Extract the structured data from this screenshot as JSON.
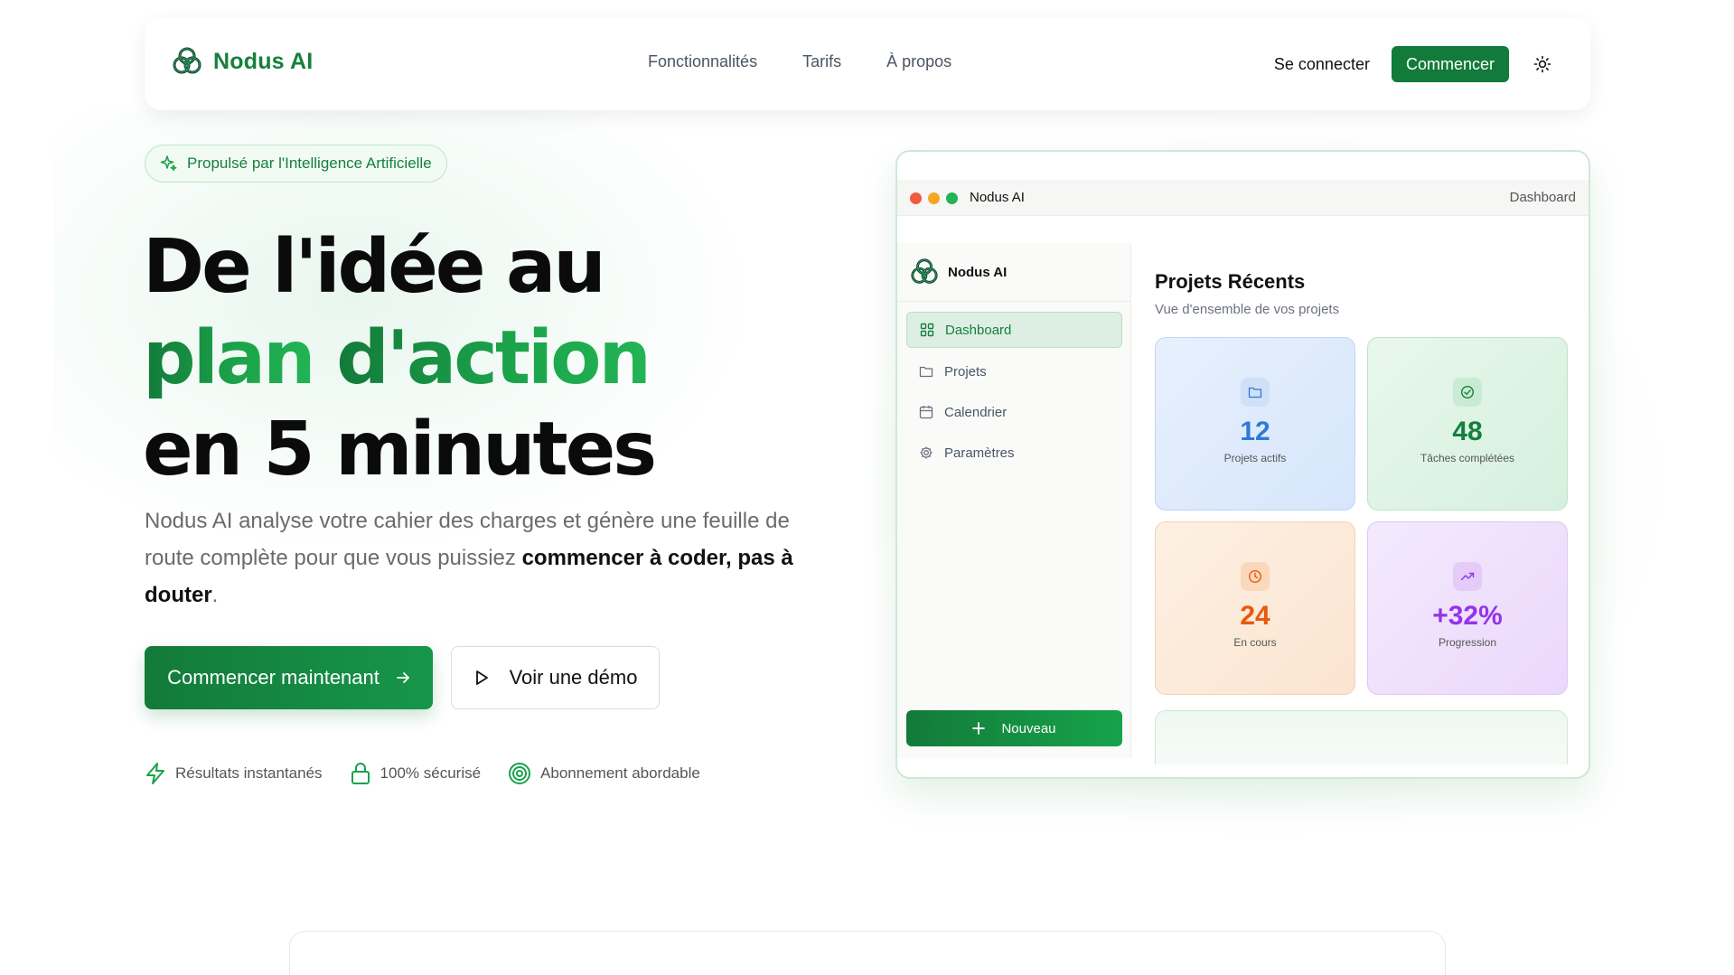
{
  "nav": {
    "brand": "Nodus AI",
    "links": [
      "Fonctionnalités",
      "Tarifs",
      "À propos"
    ],
    "login": "Se connecter",
    "start": "Commencer"
  },
  "hero": {
    "badge": "Propulsé par l'Intelligence Artificielle",
    "headline_line1": "De l'idée au",
    "headline_line2a": "plan",
    "headline_line2b": "d'action",
    "headline_line3": "en 5 minutes",
    "subtitle_part1": "Nodus AI analyse votre cahier des charges et génère une feuille de route complète pour que vous puissiez",
    "subtitle_bold": "commencer à coder, pas à douter",
    "subtitle_end": ".",
    "cta_primary": "Commencer maintenant",
    "cta_secondary": "Voir une démo",
    "features": [
      "Résultats instantanés",
      "100% sécurisé",
      "Abonnement abordable"
    ]
  },
  "mockup": {
    "window_title": "Nodus AI",
    "window_tab": "Dashboard",
    "sidebar_brand": "Nodus AI",
    "sidebar_items": [
      "Dashboard",
      "Projets",
      "Calendrier",
      "Paramètres"
    ],
    "new_button": "Nouveau",
    "main_title": "Projets Récents",
    "main_subtitle": "Vue d'ensemble de vos projets",
    "stats": [
      {
        "value": "12",
        "label": "Projets actifs"
      },
      {
        "value": "48",
        "label": "Tâches complétées"
      },
      {
        "value": "24",
        "label": "En cours"
      },
      {
        "value": "+32%",
        "label": "Progression"
      }
    ]
  },
  "colors": {
    "brand_green": "#15803d",
    "blue": "#2f7ad8",
    "green": "#15803d",
    "orange": "#ea580c",
    "purple": "#9333ea"
  }
}
